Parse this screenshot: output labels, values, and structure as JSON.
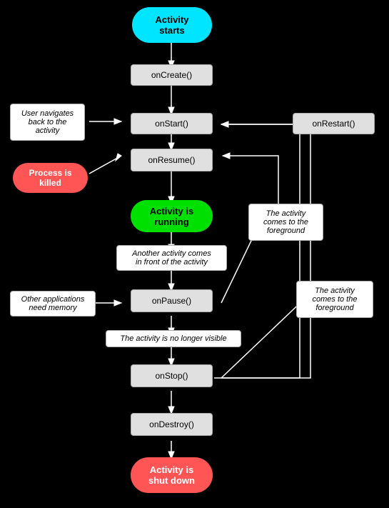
{
  "nodes": {
    "activity_starts": "Activity\nstarts",
    "on_create": "onCreate()",
    "on_start": "onStart()",
    "on_restart": "onRestart()",
    "on_resume": "onResume()",
    "activity_running": "Activity is\nrunning",
    "on_pause": "onPause()",
    "on_stop": "onStop()",
    "on_destroy": "onDestroy()",
    "activity_shutdown": "Activity is\nshut down"
  },
  "labels": {
    "user_navigates": "User navigates\nback to the\nactivity",
    "process_killed": "Process is\nkilled",
    "another_activity": "Another activity comes\nin front of the activity",
    "other_apps": "Other applications\nneed memory",
    "no_longer_visible": "The activity is no longer visible",
    "foreground1": "The activity\ncomes to the\nforeground",
    "foreground2": "The activity\ncomes to the\nforeground"
  }
}
